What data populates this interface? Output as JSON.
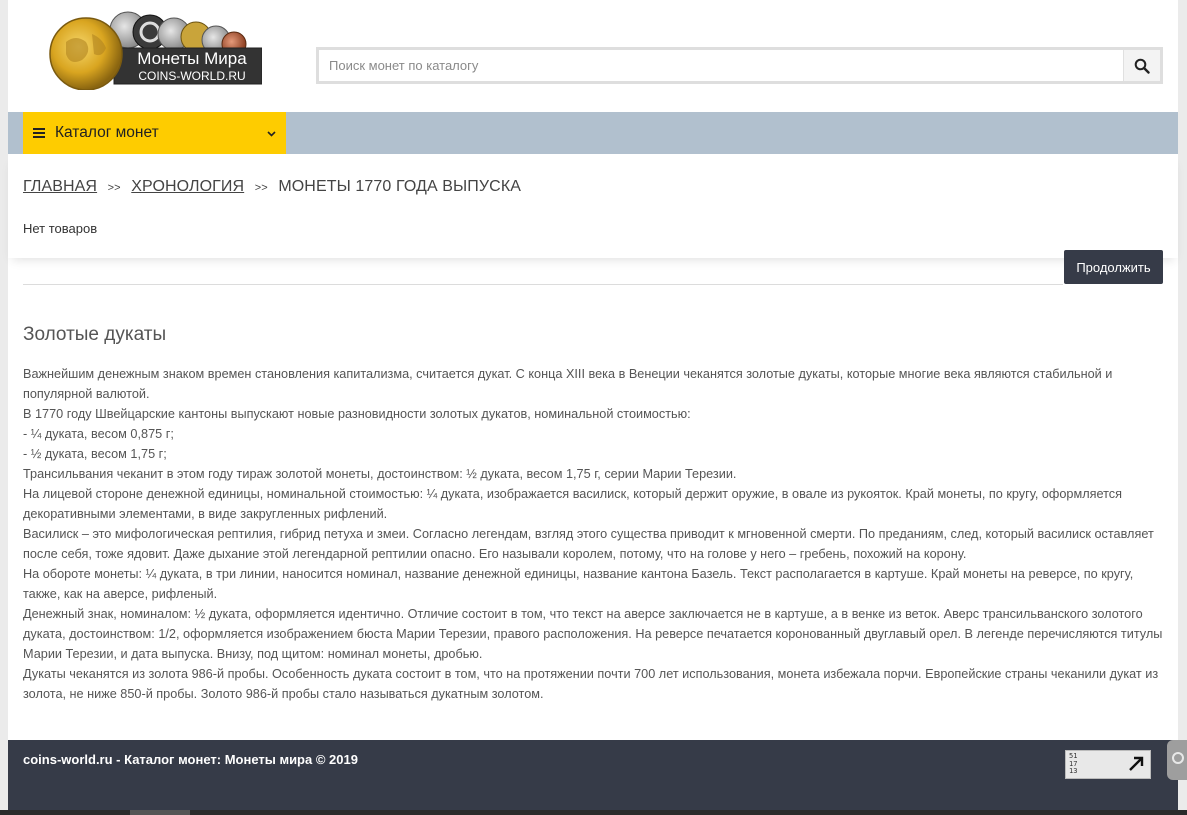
{
  "header": {
    "logo_text": "Монеты Мира",
    "logo_subtext": "COINS-WORLD.RU",
    "search_placeholder": "Поиск монет по каталогу",
    "search_icon": "search-icon"
  },
  "nav": {
    "catalog_label": "Каталог монет",
    "menu_icon": "hamburger-icon",
    "chevron_icon": "chevron-down-icon"
  },
  "breadcrumb": {
    "home": "ГЛАВНАЯ",
    "sep": ">>",
    "chronology": "ХРОНОЛОГИЯ",
    "current": "МОНЕТЫ 1770 ГОДА ВЫПУСКА"
  },
  "content": {
    "no_products": "Нет товаров",
    "continue_label": "Продолжить",
    "section_title": "Золотые дукаты",
    "paragraphs": [
      "Важнейшим денежным знаком времен становления капитализма, считается дукат. С конца XIII века в Венеции чеканятся золотые дукаты, которые многие века являются стабильной и популярной валютой.",
      "В 1770 году Швейцарские кантоны выпускают новые разновидности золотых дукатов, номинальной стоимостью:",
      "- ¼ дуката, весом 0,875 г;",
      "- ½ дуката, весом 1,75 г;",
      "Трансильвания чеканит в этом году тираж золотой монеты, достоинством: ½ дуката, весом 1,75 г, серии Марии Терезии.",
      "На лицевой стороне денежной единицы, номинальной стоимостью: ¼ дуката, изображается василиск, который держит оружие, в овале из рукояток. Край монеты, по кругу, оформляется декоративными элементами, в виде закругленных рифлений.",
      "Василиск – это мифологическая рептилия, гибрид петуха и змеи. Согласно легендам, взгляд этого существа приводит к мгновенной смерти. По преданиям, след, который василиск оставляет после себя, тоже ядовит. Даже дыхание этой легендарной рептилии опасно. Его называли королем, потому, что на голове у него – гребень, похожий на корону.",
      "На обороте монеты: ¼ дуката, в три линии, наносится номинал, название денежной единицы, название кантона Базель. Текст располагается в картуше. Край монеты на реверсе, по кругу, также, как на аверсе, рифленый.",
      "Денежный знак, номиналом: ½ дуката, оформляется идентично. Отличие состоит в том, что текст на аверсе заключается не в картуше, а в венке из веток. Аверс трансильванского золотого дуката, достоинством: 1/2, оформляется изображением бюста Марии Терезии, правого расположения. На реверсе печатается коронованный двуглавый орел. В легенде перечисляются титулы Марии Терезии, и дата выпуска. Внизу, под щитом: номинал монеты, дробью.",
      "Дукаты чеканятся из золота 986-й пробы. Особенность дуката состоит в том, что на протяжении почти 700 лет использования, монета избежала порчи. Европейские страны чеканили дукат из золота, не ниже 850-й пробы. Золото 986-й пробы стало называться дукатным золотом."
    ]
  },
  "footer": {
    "text": "coins-world.ru - Каталог монет: Монеты мира © 2019",
    "counter_lines": [
      "51",
      "17",
      "13"
    ]
  },
  "colors": {
    "accent_yellow": "#fecc00",
    "navbar": "#b1c0ce",
    "dark": "#363b48"
  }
}
